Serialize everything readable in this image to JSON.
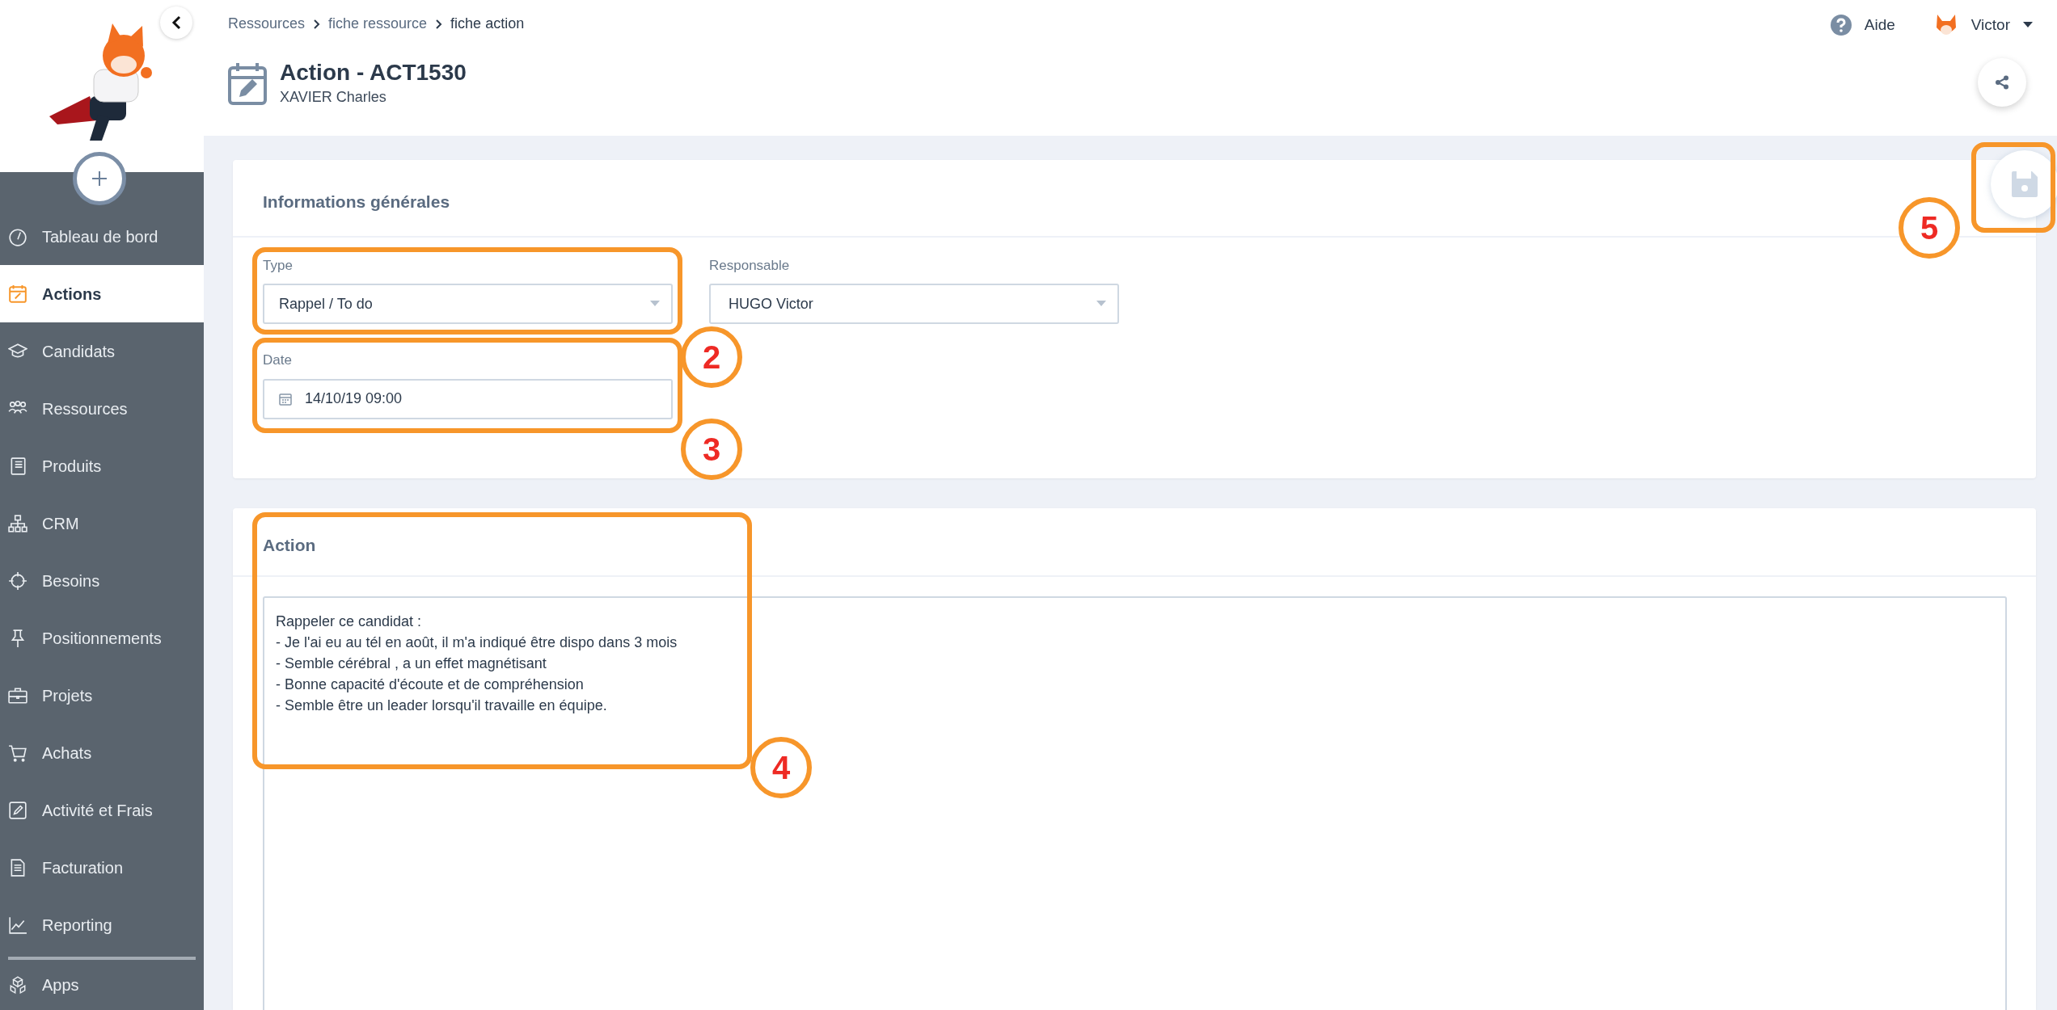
{
  "sidebar": {
    "items": [
      {
        "label": "Tableau de bord",
        "selected": false
      },
      {
        "label": "Actions",
        "selected": true
      },
      {
        "label": "Candidats",
        "selected": false
      },
      {
        "label": "Ressources",
        "selected": false
      },
      {
        "label": "Produits",
        "selected": false
      },
      {
        "label": "CRM",
        "selected": false
      },
      {
        "label": "Besoins",
        "selected": false
      },
      {
        "label": "Positionnements",
        "selected": false
      },
      {
        "label": "Projets",
        "selected": false
      },
      {
        "label": "Achats",
        "selected": false
      },
      {
        "label": "Activité et Frais",
        "selected": false
      },
      {
        "label": "Facturation",
        "selected": false
      },
      {
        "label": "Reporting",
        "selected": false
      }
    ],
    "footer_items": [
      {
        "label": "Apps",
        "selected": false
      }
    ]
  },
  "header": {
    "breadcrumb": [
      {
        "label": "Ressources",
        "current": false
      },
      {
        "label": "fiche ressource",
        "current": false
      },
      {
        "label": "fiche action",
        "current": true
      }
    ],
    "title": "Action - ACT1530",
    "subtitle": "XAVIER Charles",
    "help": "Aide",
    "user": "Victor"
  },
  "general": {
    "title": "Informations générales",
    "type": {
      "label": "Type",
      "value": "Rappel / To do"
    },
    "responsable": {
      "label": "Responsable",
      "value": "HUGO Victor"
    },
    "date": {
      "label": "Date",
      "value": "14/10/19 09:00"
    }
  },
  "action": {
    "title": "Action",
    "text": "Rappeler ce candidat :\n- Je l'ai eu au tél en août, il m'a indiqué être dispo dans 3 mois\n- Semble cérébral , a un effet magnétisant\n- Bonne capacité d'écoute et de compréhension\n- Semble être un leader lorsqu'il travaille en équipe."
  },
  "callouts": [
    {
      "label": "2"
    },
    {
      "label": "3"
    },
    {
      "label": "4"
    },
    {
      "label": "5"
    }
  ]
}
